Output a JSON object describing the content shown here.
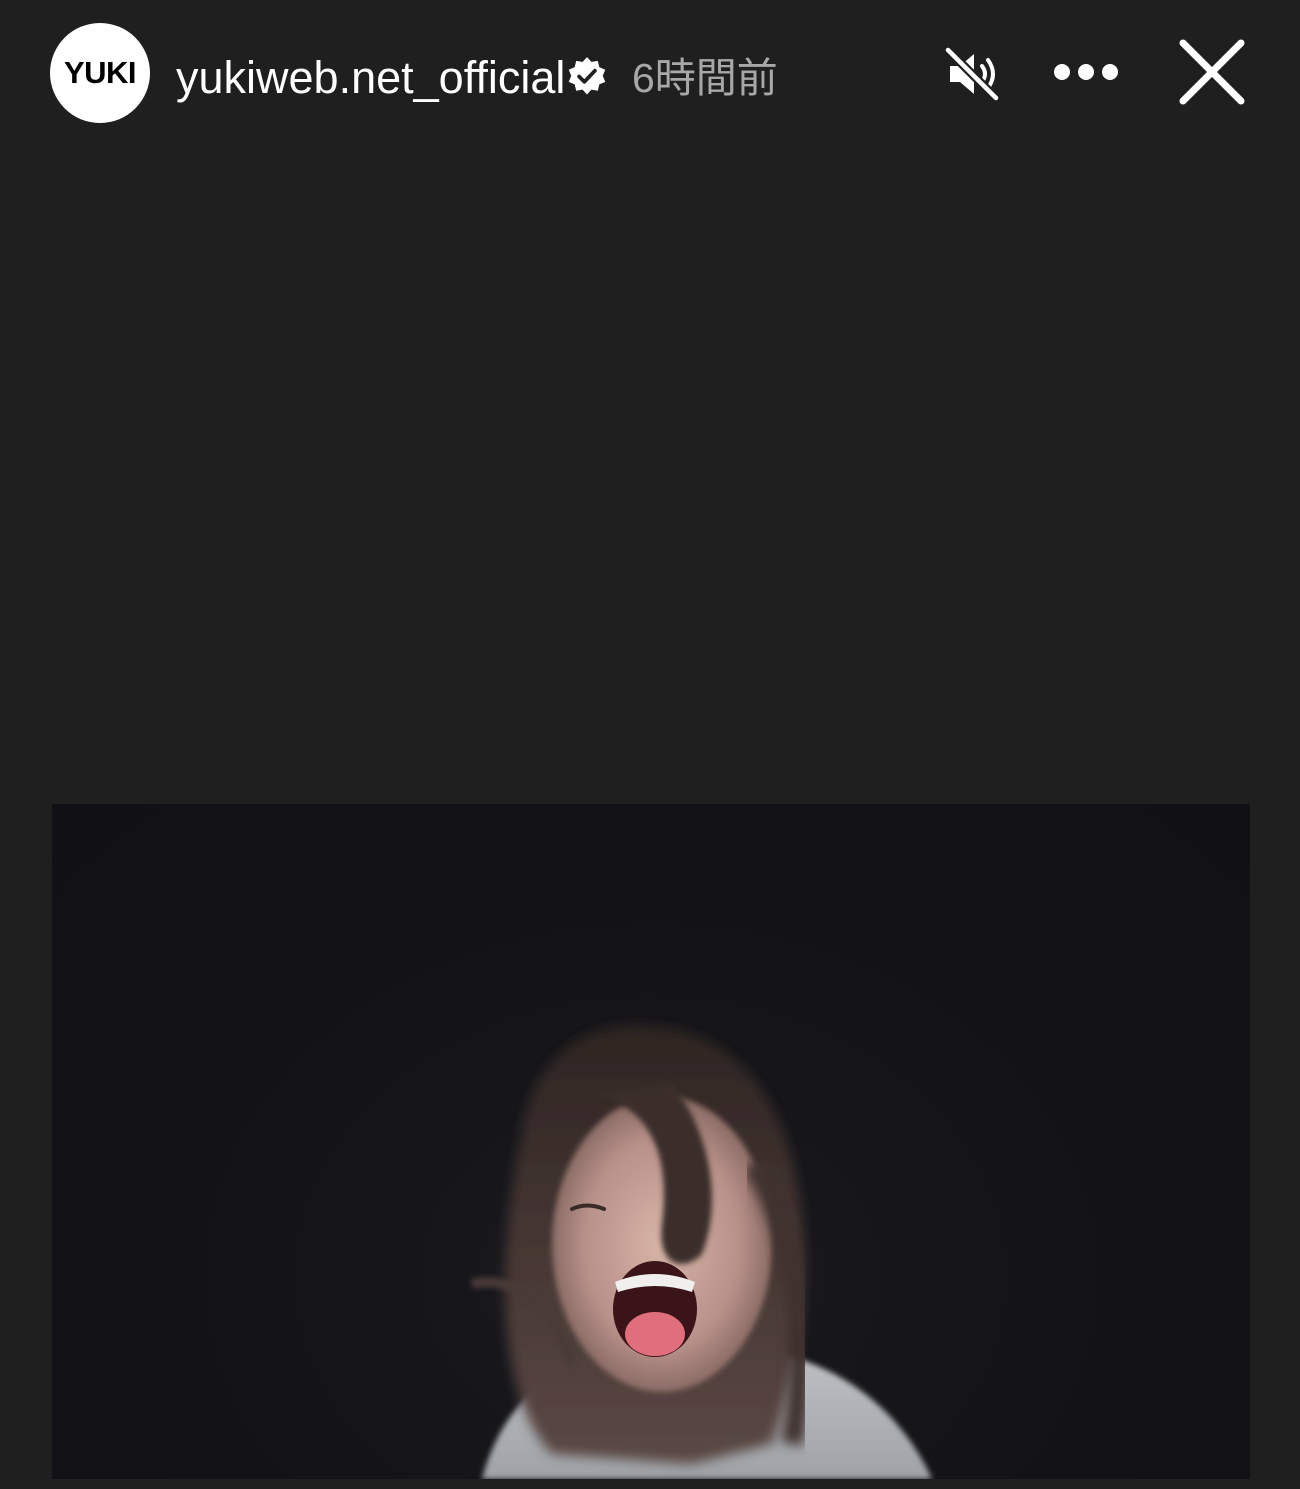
{
  "header": {
    "avatar_text": "YUKI",
    "username": "yukiweb.net_official",
    "timestamp": "6時間前"
  },
  "icons": {
    "verified": "verified-badge-icon",
    "mute": "speaker-muted-icon",
    "more": "more-horizontal-icon",
    "close": "close-icon"
  },
  "colors": {
    "background": "#1f1f20",
    "text_primary": "#ffffff",
    "text_secondary": "#a8a8a8",
    "media_background": "#121216"
  }
}
